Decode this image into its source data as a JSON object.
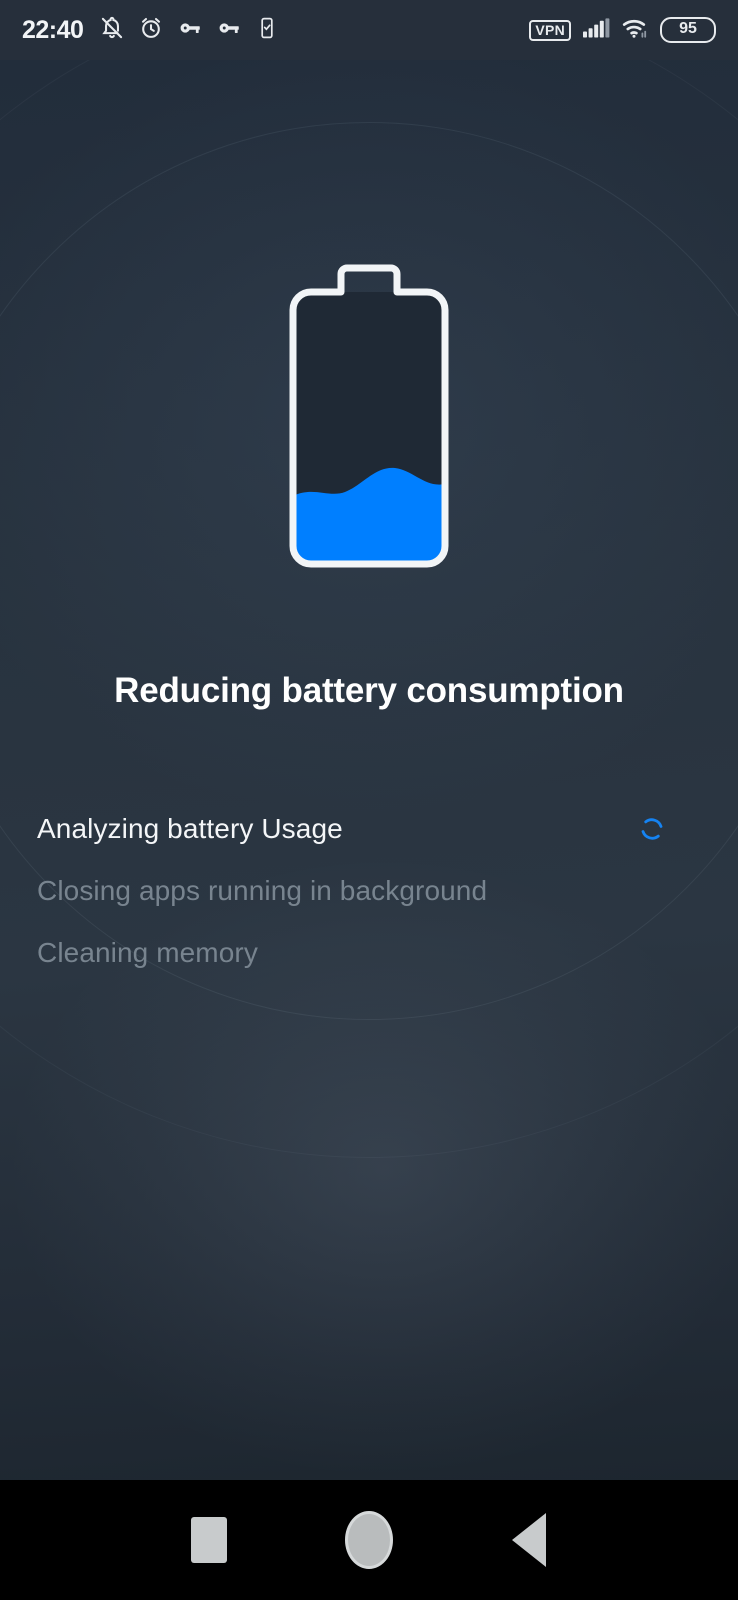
{
  "status_bar": {
    "time": "22:40",
    "left_icons": [
      {
        "name": "notifications-off-icon",
        "glyph": "bell-slash"
      },
      {
        "name": "alarm-clock-icon",
        "glyph": "alarm"
      },
      {
        "name": "vpn-key-icon",
        "glyph": "key"
      },
      {
        "name": "vpn-key-secondary-icon",
        "glyph": "key"
      },
      {
        "name": "device-check-icon",
        "glyph": "phone-check"
      }
    ],
    "vpn_label": "VPN",
    "right_icons": [
      {
        "name": "cellular-signal-icon",
        "glyph": "signal-bars"
      },
      {
        "name": "wifi-icon",
        "glyph": "wifi"
      }
    ],
    "battery_level": "95"
  },
  "main": {
    "title": "Reducing battery consumption",
    "battery_fill_percent": 25,
    "steps": [
      {
        "label": "Analyzing battery Usage",
        "state": "active"
      },
      {
        "label": "Closing apps running in background",
        "state": "pending"
      },
      {
        "label": "Cleaning memory",
        "state": "pending"
      }
    ]
  },
  "nav_bar": {
    "recents_label": "Recents",
    "home_label": "Home",
    "back_label": "Back"
  },
  "colors": {
    "accent_blue": "#007FFF",
    "background_dark": "#232e3c",
    "text_primary": "#ffffff",
    "text_muted": "#78848f",
    "battery_outline": "#f2f5f7"
  }
}
